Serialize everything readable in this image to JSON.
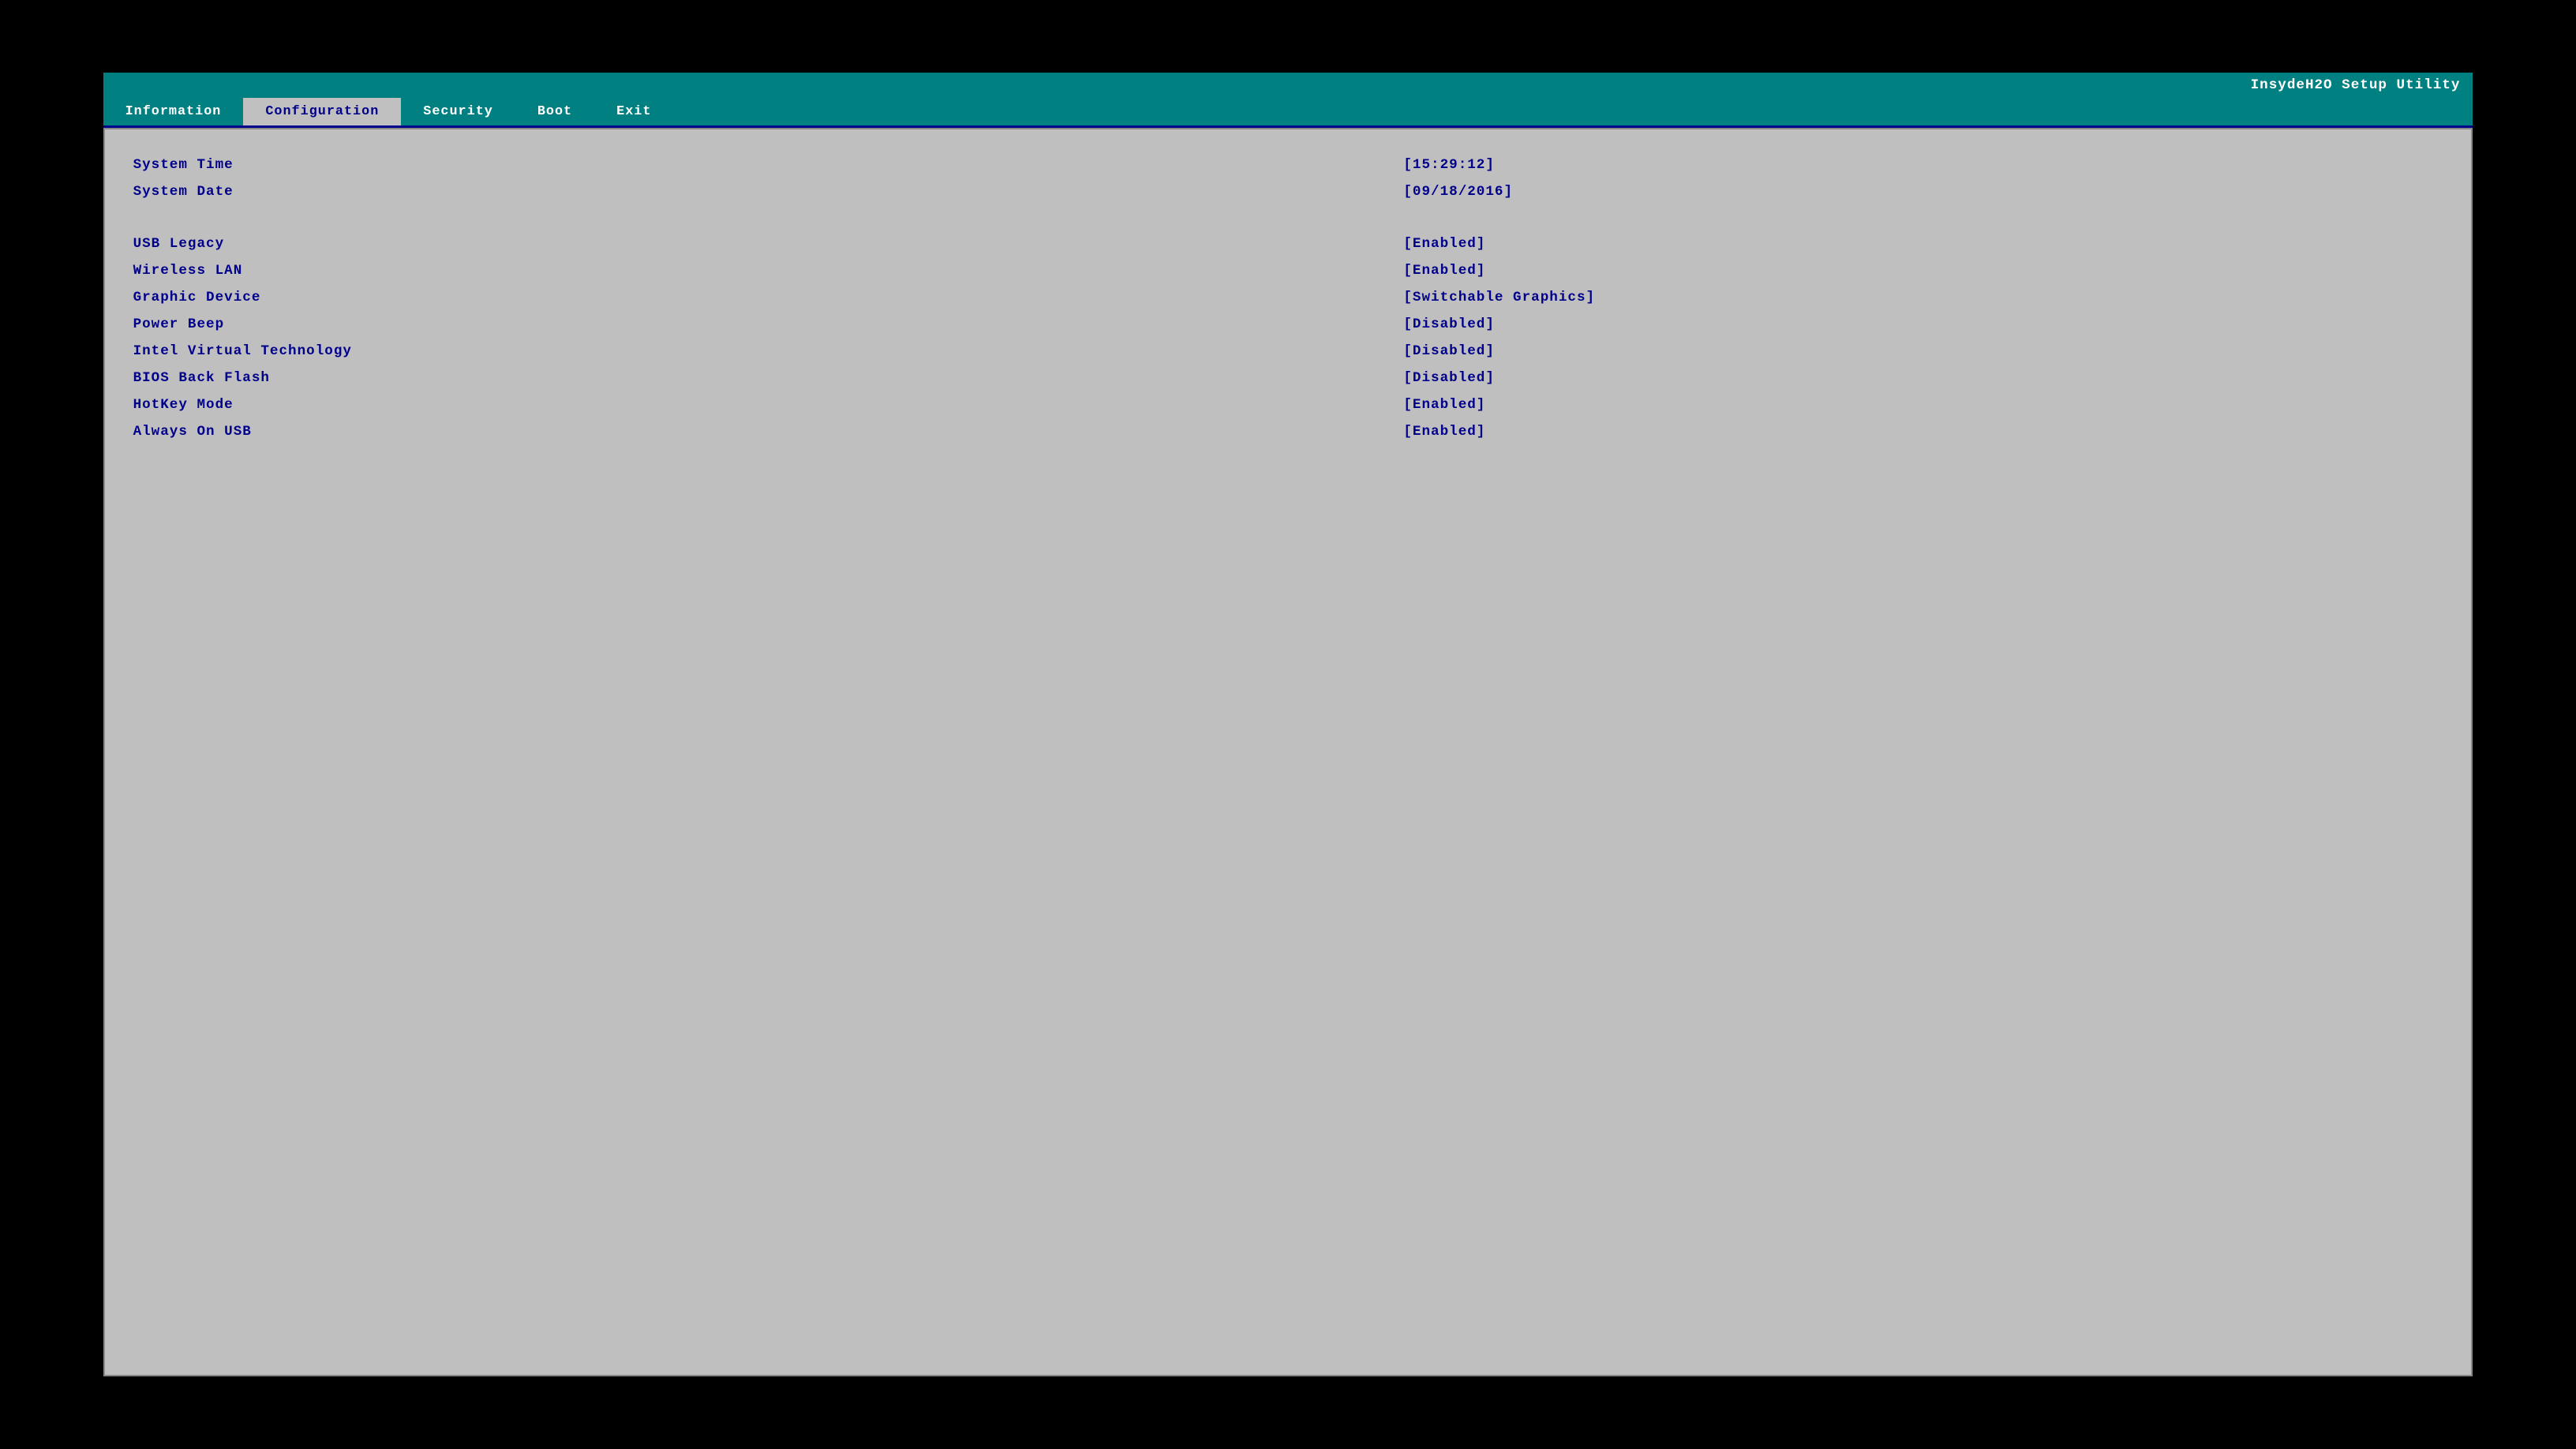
{
  "titlebar": {
    "label": "InsydeH2O Setup Utility"
  },
  "navbar": {
    "items": [
      {
        "id": "information",
        "label": "Information",
        "active": false
      },
      {
        "id": "configuration",
        "label": "Configuration",
        "active": true
      },
      {
        "id": "security",
        "label": "Security",
        "active": false
      },
      {
        "id": "boot",
        "label": "Boot",
        "active": false
      },
      {
        "id": "exit",
        "label": "Exit",
        "active": false
      }
    ]
  },
  "settings": {
    "rows": [
      {
        "label": "System Time",
        "value": "[15:29:12]",
        "spacer_before": false
      },
      {
        "label": "System Date",
        "value": "[09/18/2016]",
        "spacer_before": false
      },
      {
        "label": "",
        "value": "",
        "spacer_before": true
      },
      {
        "label": "USB Legacy",
        "value": "[Enabled]",
        "spacer_before": false
      },
      {
        "label": "Wireless LAN",
        "value": "[Enabled]",
        "spacer_before": false
      },
      {
        "label": "Graphic Device",
        "value": "[Switchable Graphics]",
        "spacer_before": false
      },
      {
        "label": "Power Beep",
        "value": "[Disabled]",
        "spacer_before": false
      },
      {
        "label": "Intel Virtual Technology",
        "value": "[Disabled]",
        "spacer_before": false
      },
      {
        "label": "BIOS Back Flash",
        "value": "[Disabled]",
        "spacer_before": false
      },
      {
        "label": "HotKey Mode",
        "value": "[Enabled]",
        "spacer_before": false
      },
      {
        "label": "Always On USB",
        "value": "[Enabled]",
        "spacer_before": false
      }
    ]
  }
}
